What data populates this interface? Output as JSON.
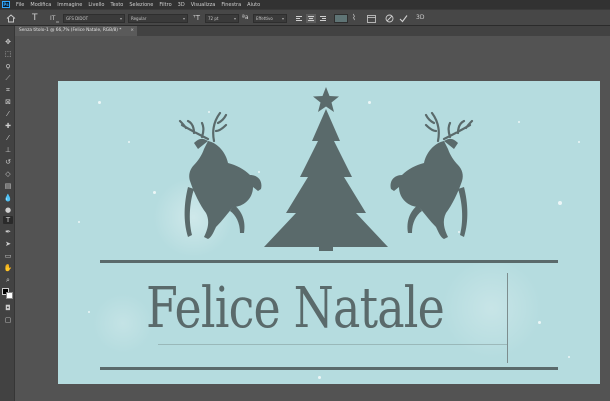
{
  "app": {
    "logo": "Ps"
  },
  "menu": [
    "File",
    "Modifica",
    "Immagine",
    "Livello",
    "Testo",
    "Selezione",
    "Filtro",
    "3D",
    "Visualizza",
    "Finestra",
    "Aiuto"
  ],
  "options": {
    "font_family": "GFS DIDOT",
    "font_style": "Regular",
    "font_size": "72 pt",
    "antialias": "Effettivo",
    "text_color": "#5f7475"
  },
  "document_tab": {
    "label": "Senza titolo-1 @ 66,7% (Felice Natale, RGB/8) *"
  },
  "canvas": {
    "headline": "Felice Natale",
    "background_color": "#b5dcdf",
    "art_color": "#5a6a6b"
  }
}
